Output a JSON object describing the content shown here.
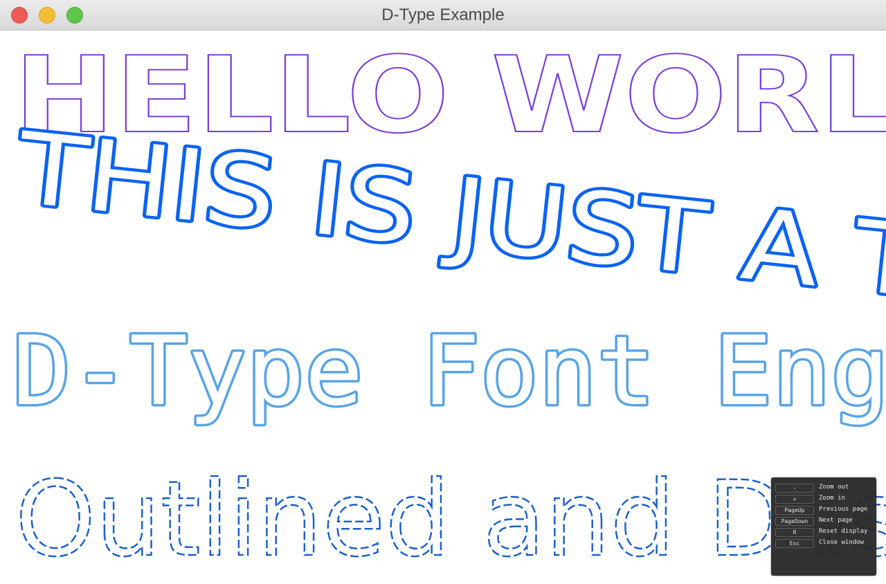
{
  "window": {
    "title": "D-Type Example",
    "buttons": {
      "close_color": "#ee5b56",
      "minimize_color": "#f5bd33",
      "maximize_color": "#5fc54b"
    }
  },
  "canvas": {
    "lines": [
      {
        "text": "HELLO WORLD",
        "style": "thin outline",
        "color": "#7a3fd6"
      },
      {
        "text": "THIS IS JUST A TEST",
        "style": "thick outline, tilted",
        "color": "#0b63f0"
      },
      {
        "text": "D-Type Font Engine",
        "style": "medium outline, slab serif",
        "color": "#58a4e6"
      },
      {
        "text": "Outlined and Dashed",
        "style": "dashed outline",
        "color": "#1a5fc8"
      }
    ]
  },
  "help": {
    "rows": [
      {
        "key": "-",
        "desc": "Zoom out"
      },
      {
        "key": "+",
        "desc": "Zoom in"
      },
      {
        "key": "PageUp",
        "desc": "Previous page"
      },
      {
        "key": "PageDown",
        "desc": "Next page"
      },
      {
        "key": "R",
        "desc": "Reset display"
      },
      {
        "key": "Esc",
        "desc": "Close window"
      }
    ]
  }
}
